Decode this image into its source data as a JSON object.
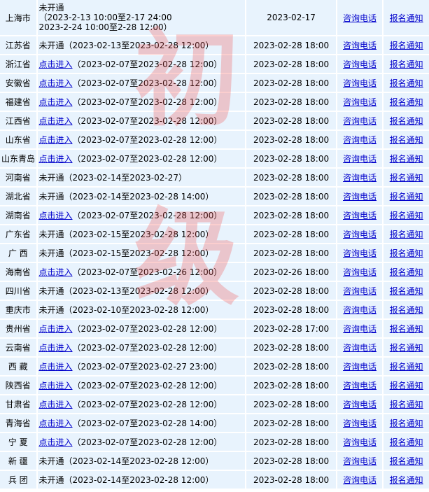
{
  "rows": [
    {
      "province": "上海市",
      "link": "",
      "status_lines": [
        "未开通",
        "（2023-2-13 10:00至2-17 24:00",
        "2023-2-24 10:00至2-28 12:00）"
      ],
      "range": "",
      "deadline": "2023-02-17",
      "consult": "咨询电话",
      "notice": "报名通知"
    },
    {
      "province": "江苏省",
      "link": "未开通",
      "range": "（2023-02-13至2023-02-28 12:00）",
      "deadline": "2023-02-28 18:00",
      "consult": "咨询电话",
      "notice": "报名通知"
    },
    {
      "province": "浙江省",
      "link": "点击进入",
      "range": "（2023-02-07至2023-02-28 12:00）",
      "deadline": "2023-02-28 18:00",
      "consult": "咨询电话",
      "notice": "报名通知"
    },
    {
      "province": "安徽省",
      "link": "点击进入",
      "range": "（2023-02-07至2023-02-28 12:00）",
      "deadline": "2023-02-28 18:00",
      "consult": "咨询电话",
      "notice": "报名通知"
    },
    {
      "province": "福建省",
      "link": "点击进入",
      "range": "（2023-02-07至2023-02-28 12:00）",
      "deadline": "2023-02-28 18:00",
      "consult": "咨询电话",
      "notice": "报名通知"
    },
    {
      "province": "江西省",
      "link": "点击进入",
      "range": "（2023-02-07至2023-02-28 12:00）",
      "deadline": "2023-02-28 18:00",
      "consult": "咨询电话",
      "notice": "报名通知"
    },
    {
      "province": "山东省",
      "link": "点击进入",
      "range": "（2023-02-07至2023-02-28 12:00）",
      "deadline": "2023-02-28 18:00",
      "consult": "咨询电话",
      "notice": "报名通知"
    },
    {
      "province": "山东青岛",
      "link": "点击进入",
      "range": "（2023-02-07至2023-02-28 12:00）",
      "deadline": "2023-02-28 18:00",
      "consult": "咨询电话",
      "notice": "报名通知"
    },
    {
      "province": "河南省",
      "link": "未开通",
      "range": "（2023-02-14至2023-02-27）",
      "deadline": "2023-02-28 18:00",
      "consult": "咨询电话",
      "notice": "报名通知"
    },
    {
      "province": "湖北省",
      "link": "未开通",
      "range": "（2023-02-14至2023-02-28 14:00）",
      "deadline": "2023-02-28 18:00",
      "consult": "咨询电话",
      "notice": "报名通知"
    },
    {
      "province": "湖南省",
      "link": "点击进入",
      "range": "（2023-02-07至2023-02-28 12:00）",
      "deadline": "2023-02-28 18:00",
      "consult": "咨询电话",
      "notice": "报名通知"
    },
    {
      "province": "广东省",
      "link": "未开通",
      "range": "（2023-02-15至2023-02-28 12:00）",
      "deadline": "2023-02-28 18:00",
      "consult": "咨询电话",
      "notice": "报名通知"
    },
    {
      "province": "广 西",
      "link": "未开通",
      "range": "（2023-02-15至2023-02-28 12:00）",
      "deadline": "2023-02-28 18:00",
      "consult": "咨询电话",
      "notice": "报名通知"
    },
    {
      "province": "海南省",
      "link": "点击进入",
      "range": "（2023-02-07至2023-02-26 12:00）",
      "deadline": "2023-02-26 18:00",
      "consult": "咨询电话",
      "notice": "报名通知"
    },
    {
      "province": "四川省",
      "link": "未开通",
      "range": "（2023-02-13至2023-02-28 12:00）",
      "deadline": "2023-02-28 18:00",
      "consult": "咨询电话",
      "notice": "报名通知"
    },
    {
      "province": "重庆市",
      "link": "未开通",
      "range": "（2023-02-10至2023-02-28 12:00）",
      "deadline": "2023-02-28 18:00",
      "consult": "咨询电话",
      "notice": "报名通知"
    },
    {
      "province": "贵州省",
      "link": "点击进入",
      "range": "（2023-02-07至2023-02-28 12:00）",
      "deadline": "2023-02-28 17:00",
      "consult": "咨询电话",
      "notice": "报名通知"
    },
    {
      "province": "云南省",
      "link": "点击进入",
      "range": "（2023-02-07至2023-02-28 12:00）",
      "deadline": "2023-02-28 18:00",
      "consult": "咨询电话",
      "notice": "报名通知"
    },
    {
      "province": "西 藏",
      "link": "点击进入",
      "range": "（2023-02-07至2023-02-27 23:00）",
      "deadline": "2023-02-28 18:00",
      "consult": "咨询电话",
      "notice": "报名通知"
    },
    {
      "province": "陕西省",
      "link": "点击进入",
      "range": "（2023-02-07至2023-02-28 12:00）",
      "deadline": "2023-02-28 18:00",
      "consult": "咨询电话",
      "notice": "报名通知"
    },
    {
      "province": "甘肃省",
      "link": "点击进入",
      "range": "（2023-02-07至2023-02-28 12:00）",
      "deadline": "2023-02-28 18:00",
      "consult": "咨询电话",
      "notice": "报名通知"
    },
    {
      "province": "青海省",
      "link": "点击进入",
      "range": "（2023-02-07至2023-02-28 14:00）",
      "deadline": "2023-02-28 18:00",
      "consult": "咨询电话",
      "notice": "报名通知"
    },
    {
      "province": "宁 夏",
      "link": "点击进入",
      "range": "（2023-02-07至2023-02-28 12:00）",
      "deadline": "2023-02-28 18:00",
      "consult": "咨询电话",
      "notice": "报名通知"
    },
    {
      "province": "新 疆",
      "link": "未开通",
      "range": "（2023-02-14至2023-02-28 12:00）",
      "deadline": "2023-02-28 18:00",
      "consult": "咨询电话",
      "notice": "报名通知"
    },
    {
      "province": "兵 团",
      "link": "未开通",
      "range": "（2023-02-14至2023-02-28 12:00）",
      "deadline": "2023-02-28 18:00",
      "consult": "咨询电话",
      "notice": "报名通知"
    }
  ],
  "watermark": {
    "char1": "初",
    "char2": "级"
  },
  "colors": {
    "cell_bg": "#e8f3fd",
    "link": "#0000cc",
    "watermark": "#f05050"
  }
}
